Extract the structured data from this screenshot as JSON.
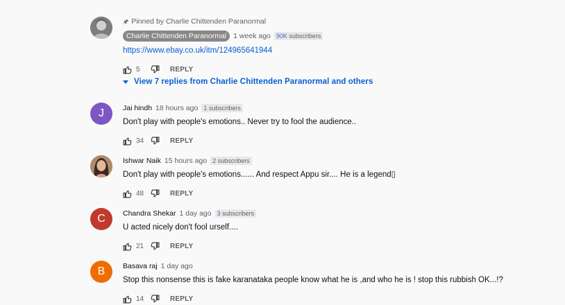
{
  "pinned_comment": {
    "pinned_label": "Pinned by Charlie Chittenden Paranormal",
    "author": "Charlie Chittenden Paranormal",
    "time": "1 week ago",
    "subs_count": "90K",
    "subs_label": "subscribers",
    "text": "https://www.ebay.co.uk/itm/124965641944",
    "likes": "5",
    "reply": "REPLY",
    "avatar_color": "#8a8a8a"
  },
  "view_replies": "View 7 replies from Charlie Chittenden Paranormal and others",
  "comments": [
    {
      "avatar_letter": "J",
      "avatar_color": "#7e57c2",
      "author": "Jai hindh",
      "time": "18 hours ago",
      "subs_count": "1",
      "subs_label": "subscribers",
      "text": "Don't play with people's emotions.. Never try to fool the audience..",
      "likes": "34",
      "reply": "REPLY"
    },
    {
      "avatar_letter": "",
      "avatar_color": "#c9a27e",
      "author": "Ishwar Naik",
      "time": "15 hours ago",
      "subs_count": "2",
      "subs_label": "subscribers",
      "text": "Don't play with people's emotions...... And respect Appu sir.... He is a legend▯",
      "likes": "48",
      "reply": "REPLY"
    },
    {
      "avatar_letter": "C",
      "avatar_color": "#c0392b",
      "author": "Chandra Shekar",
      "time": "1 day ago",
      "subs_count": "3",
      "subs_label": "subscribers",
      "text": "U acted nicely don't fool urself....",
      "likes": "21",
      "reply": "REPLY"
    },
    {
      "avatar_letter": "B",
      "avatar_color": "#ef6c00",
      "author": "Basava raj",
      "time": "1 day ago",
      "subs_count": "",
      "subs_label": "",
      "text": "Stop this nonsense this is fake karanataka people know what he is ,and who he is ! stop this  rubbish OK...!?",
      "likes": "14",
      "reply": "REPLY"
    }
  ],
  "icons": {
    "pin": "pin-icon",
    "like": "thumb-up-icon",
    "dislike": "thumb-down-icon",
    "caret": "caret-down-icon"
  }
}
